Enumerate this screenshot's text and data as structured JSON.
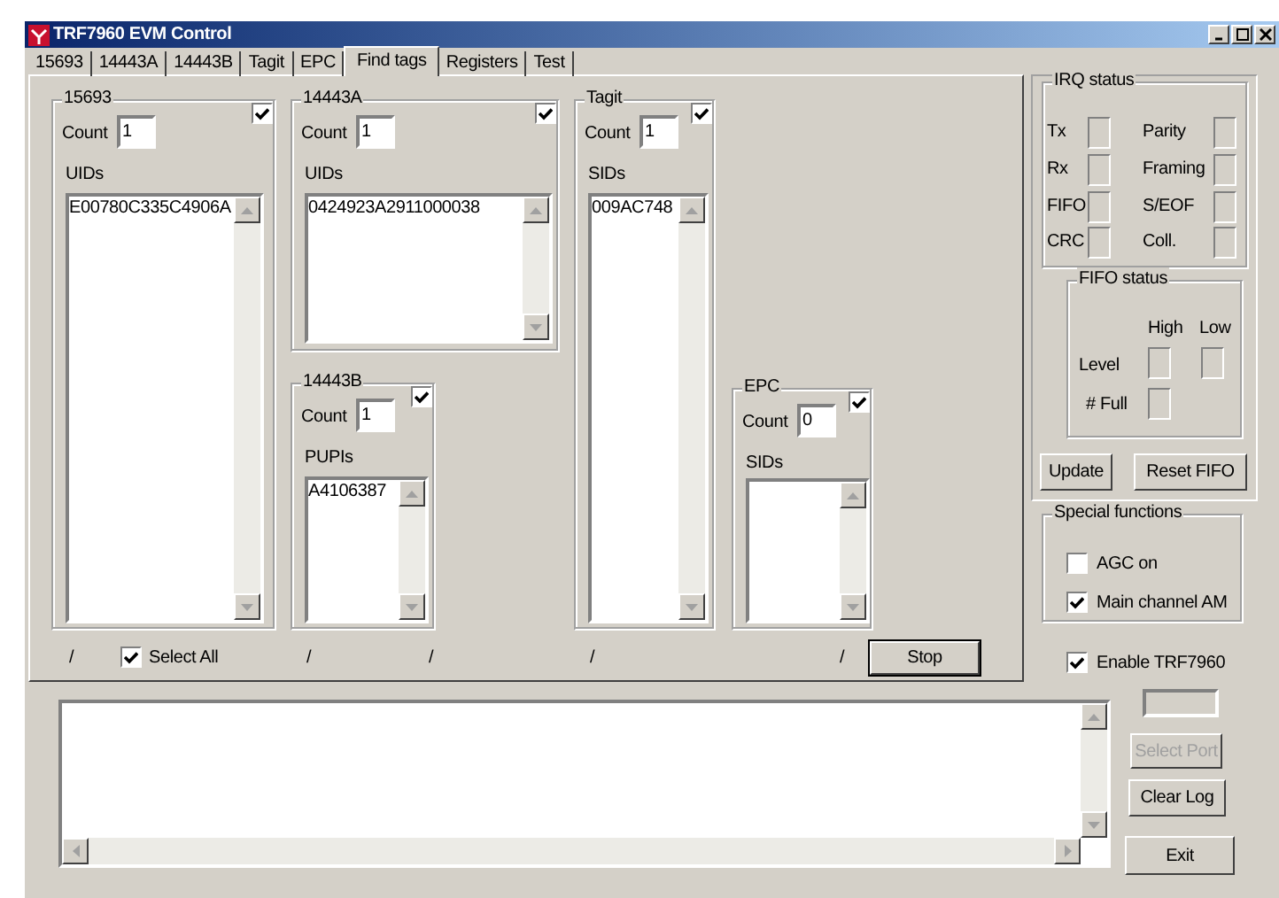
{
  "window": {
    "title": "TRF7960 EVM Control"
  },
  "tabs": [
    {
      "label": "15693",
      "selected": false
    },
    {
      "label": "14443A",
      "selected": false
    },
    {
      "label": "14443B",
      "selected": false
    },
    {
      "label": "Tagit",
      "selected": false
    },
    {
      "label": "EPC",
      "selected": false
    },
    {
      "label": "Find tags",
      "selected": true
    },
    {
      "label": "Registers",
      "selected": false
    },
    {
      "label": "Test",
      "selected": false
    }
  ],
  "tag_groups": [
    {
      "title": "15693",
      "checked": true,
      "count_label": "Count",
      "count": "1",
      "list_label": "UIDs",
      "items": [
        "E00780C335C4906A"
      ]
    },
    {
      "title": "14443A",
      "checked": true,
      "count_label": "Count",
      "count": "1",
      "list_label": "UIDs",
      "items": [
        "0424923A2911000038"
      ]
    },
    {
      "title": "14443B",
      "checked": true,
      "count_label": "Count",
      "count": "1",
      "list_label": "PUPIs",
      "items": [
        "A4106387"
      ]
    },
    {
      "title": "Tagit",
      "checked": true,
      "count_label": "Count",
      "count": "1",
      "list_label": "SIDs",
      "items": [
        "009AC748"
      ]
    },
    {
      "title": "EPC",
      "checked": true,
      "count_label": "Count",
      "count": "0",
      "list_label": "SIDs"
    }
  ],
  "status_marks": [
    "/",
    "/",
    "/",
    "/",
    "/"
  ],
  "select_all": {
    "label": "Select All",
    "checked": true
  },
  "stop_button": {
    "label": "Stop"
  },
  "irq_status": {
    "title": "IRQ status",
    "flags": [
      {
        "label": "Tx"
      },
      {
        "label": "Parity"
      },
      {
        "label": "Rx"
      },
      {
        "label": "Framing"
      },
      {
        "label": "FIFO"
      },
      {
        "label": "S/EOF"
      },
      {
        "label": "CRC"
      },
      {
        "label": "Coll."
      }
    ]
  },
  "fifo_status": {
    "title": "FIFO status",
    "columns": [
      "High",
      "Low"
    ],
    "rows": [
      "Level",
      "# Full"
    ]
  },
  "fifo_buttons": [
    "Update",
    "Reset FIFO"
  ],
  "special_functions": {
    "title": "Special functions",
    "options": [
      {
        "label": "AGC on",
        "checked": false
      },
      {
        "label": "Main channel AM",
        "checked": true
      }
    ]
  },
  "enable_option": {
    "label": "Enable TRF7960",
    "checked": true
  },
  "side_buttons": [
    {
      "label": "Select Port",
      "disabled": true
    },
    {
      "label": "Clear Log",
      "disabled": false
    },
    {
      "label": "Exit",
      "disabled": false
    }
  ]
}
